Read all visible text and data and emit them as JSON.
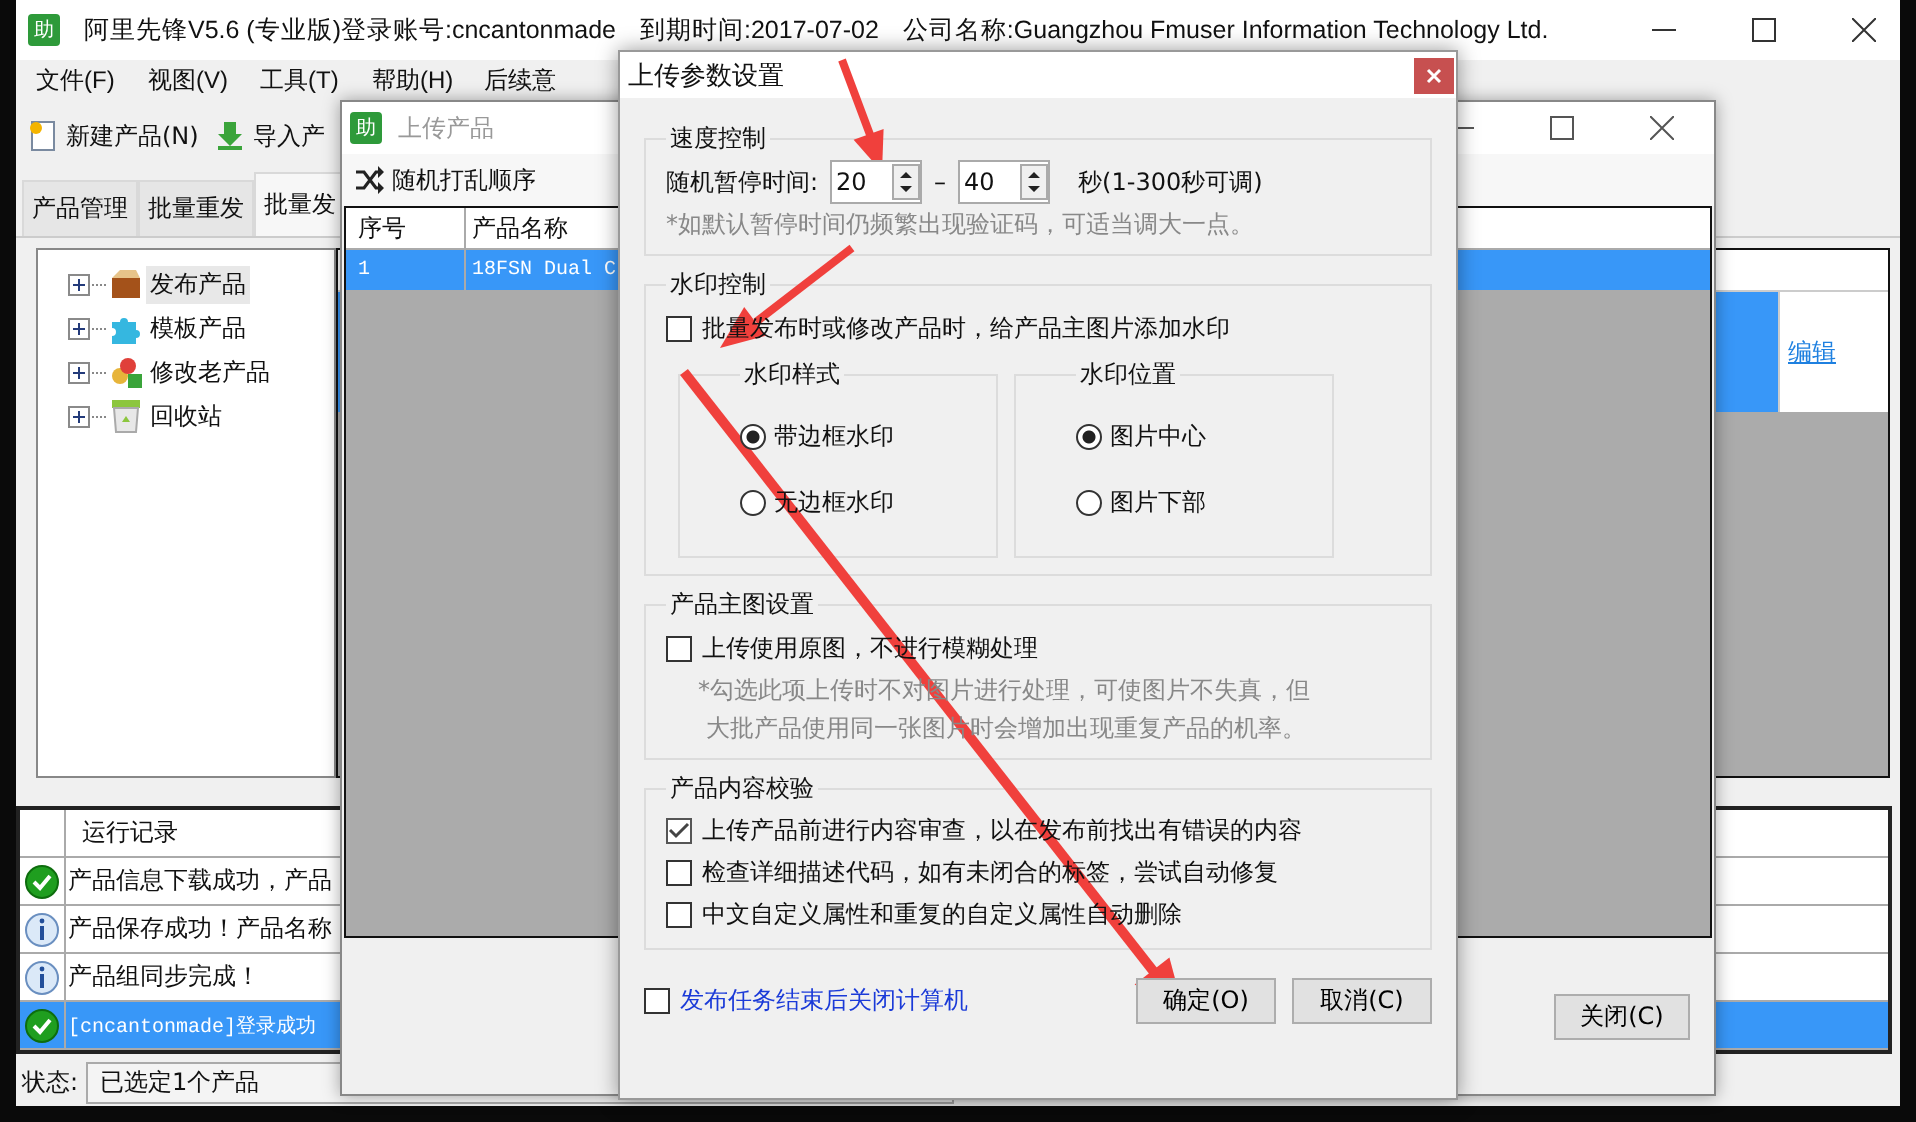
{
  "main_window": {
    "app_icon": "助",
    "title_parts": [
      "阿里先锋V5.6 (专业版)登录账号:cncantonmade",
      "到期时间:2017-07-02",
      "公司名称:Guangzhou Fmuser Information Technology Ltd."
    ],
    "menu": [
      "文件(F)",
      "视图(V)",
      "工具(T)",
      "帮助(H)",
      "后续意"
    ],
    "toolbar": [
      {
        "label": "新建产品(N)"
      },
      {
        "label": "导入产"
      }
    ],
    "tabs": [
      {
        "label": "产品管理",
        "selected": false
      },
      {
        "label": "批量重发",
        "selected": false
      },
      {
        "label": "批量发",
        "selected": true
      }
    ],
    "tree": [
      {
        "label": "发布产品",
        "expanded": false,
        "selected": true
      },
      {
        "label": "模板产品",
        "expanded": false,
        "selected": false
      },
      {
        "label": "修改老产品",
        "expanded": false,
        "selected": false
      },
      {
        "label": "回收站",
        "expanded": false,
        "selected": false
      }
    ],
    "right_table": {
      "rows": [
        {
          "selected": true,
          "action": "编辑"
        }
      ]
    },
    "log": {
      "header": "运行记录",
      "rows": [
        {
          "kind": "success",
          "text": "产品信息下载成功，产品",
          "selected": false
        },
        {
          "kind": "info",
          "text": "产品保存成功！产品名称",
          "selected": false
        },
        {
          "kind": "info",
          "text": "产品组同步完成！",
          "selected": false
        },
        {
          "kind": "success",
          "text": "[cncantonmade]登录成功",
          "selected": true
        }
      ]
    },
    "status": {
      "label": "状态:",
      "value": "已选定1个产品"
    }
  },
  "upload_window": {
    "app_icon": "助",
    "title": "上传产品",
    "toolbar_button": "随机打乱顺序",
    "columns": [
      "序号",
      "产品名称"
    ],
    "rows": [
      {
        "cells": [
          "1",
          "18FSN Dual C"
        ],
        "selected": true
      }
    ],
    "close_button": "关闭(C)"
  },
  "dialog": {
    "title": "上传参数设置",
    "speed": {
      "title": "速度控制",
      "label": "随机暂停时间:",
      "min": "20",
      "dash": "–",
      "max": "40",
      "unit": "秒(1-300秒可调)",
      "note": "*如默认暂停时间仍频繁出现验证码，可适当调大一点。"
    },
    "watermark": {
      "title": "水印控制",
      "checkbox": {
        "label": "批量发布时或修改产品时，给产品主图片添加水印",
        "checked": false
      },
      "groups": [
        {
          "title": "水印样式",
          "options": [
            {
              "label": "带边框水印",
              "selected": true
            },
            {
              "label": "无边框水印",
              "selected": false
            }
          ]
        },
        {
          "title": "水印位置",
          "options": [
            {
              "label": "图片中心",
              "selected": true
            },
            {
              "label": "图片下部",
              "selected": false
            }
          ]
        }
      ]
    },
    "main_image": {
      "title": "产品主图设置",
      "checkbox": {
        "label": "上传使用原图，不进行模糊处理",
        "checked": false
      },
      "note_lines": [
        "*勾选此项上传时不对图片进行处理，可使图片不失真，但",
        "大批产品使用同一张图片时会增加出现重复产品的机率。"
      ]
    },
    "content_check": {
      "title": "产品内容校验",
      "items": [
        {
          "label": "上传产品前进行内容审查，以在发布前找出有错误的内容",
          "checked": true
        },
        {
          "label": "检查详细描述代码，如有未闭合的标签，尝试自动修复",
          "checked": false
        },
        {
          "label": "中文自定义属性和重复的自定义属性自动删除",
          "checked": false
        }
      ]
    },
    "shutdown": {
      "label": "发布任务结束后关闭计算机",
      "checked": false
    },
    "buttons": [
      "确定(O)",
      "取消(C)"
    ]
  }
}
